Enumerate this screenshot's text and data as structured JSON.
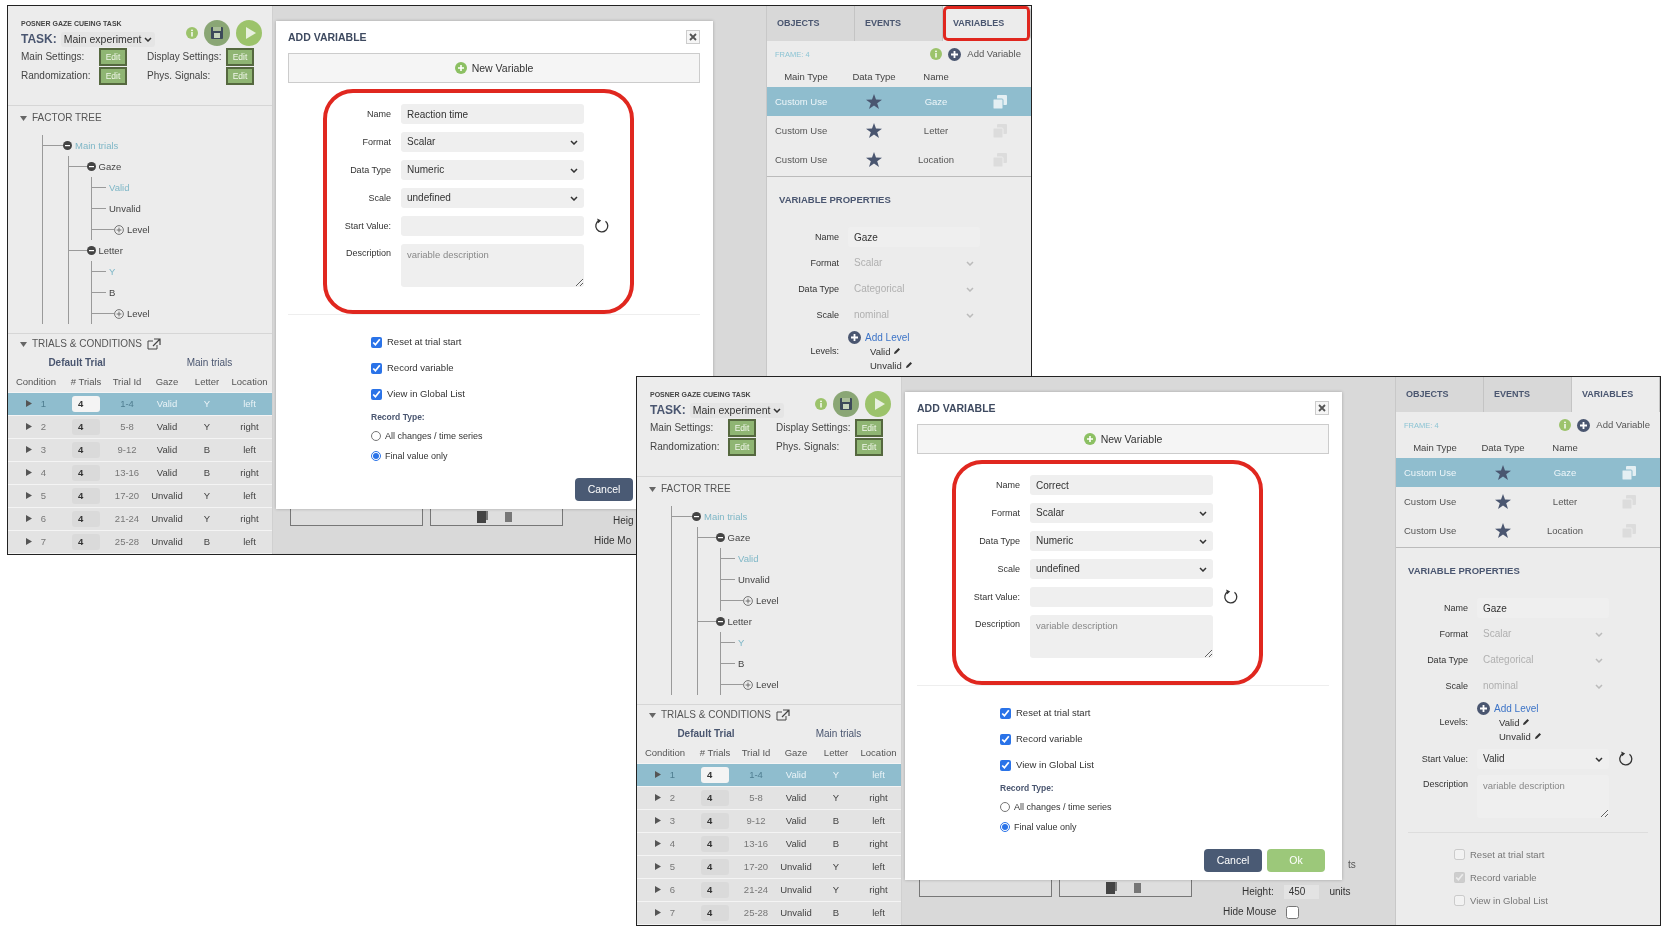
{
  "screenshots": [
    {
      "header": {
        "title": "POSNER GAZE CUEING TASK",
        "task_label": "TASK:",
        "task_value": "Main experiment",
        "settings": [
          {
            "label": "Main Settings:",
            "button": "Edit"
          },
          {
            "label": "Display Settings:",
            "button": "Edit"
          },
          {
            "label": "Randomization:",
            "button": "Edit"
          },
          {
            "label": "Phys. Signals:",
            "button": "Edit"
          }
        ]
      },
      "factor_tree": {
        "title": "FACTOR TREE",
        "nodes": [
          {
            "label": "Main trials",
            "kind": "group",
            "selected": true,
            "children": [
              {
                "label": "Gaze",
                "kind": "factor",
                "selected": false,
                "children": [
                  {
                    "label": "Valid",
                    "kind": "level",
                    "selected": true
                  },
                  {
                    "label": "Unvalid",
                    "kind": "level",
                    "selected": false
                  },
                  {
                    "label": "Level",
                    "kind": "add"
                  }
                ]
              },
              {
                "label": "Letter",
                "kind": "factor",
                "selected": false,
                "children": [
                  {
                    "label": "Y",
                    "kind": "level",
                    "selected": true
                  },
                  {
                    "label": "B",
                    "kind": "level",
                    "selected": false
                  },
                  {
                    "label": "Level",
                    "kind": "add"
                  }
                ]
              }
            ]
          }
        ]
      },
      "trials": {
        "title": "TRIALS & CONDITIONS",
        "groups": [
          "Default Trial",
          "Main trials"
        ],
        "columns": [
          "Condition",
          "# Trials",
          "Trial Id",
          "Gaze",
          "Letter",
          "Location"
        ],
        "rows": [
          {
            "selected": true,
            "cells": [
              "1",
              "4",
              "1-4",
              "Valid",
              "Y",
              "left"
            ]
          },
          {
            "selected": false,
            "cells": [
              "2",
              "4",
              "5-8",
              "Valid",
              "Y",
              "right"
            ]
          },
          {
            "selected": false,
            "cells": [
              "3",
              "4",
              "9-12",
              "Valid",
              "B",
              "left"
            ]
          },
          {
            "selected": false,
            "cells": [
              "4",
              "4",
              "13-16",
              "Valid",
              "B",
              "right"
            ]
          },
          {
            "selected": false,
            "cells": [
              "5",
              "4",
              "17-20",
              "Unvalid",
              "Y",
              "left"
            ]
          },
          {
            "selected": false,
            "cells": [
              "6",
              "4",
              "21-24",
              "Unvalid",
              "Y",
              "right"
            ]
          },
          {
            "selected": false,
            "cells": [
              "7",
              "4",
              "25-28",
              "Unvalid",
              "B",
              "left"
            ]
          }
        ]
      },
      "dialog": {
        "title": "ADD VARIABLE",
        "new_button": "New Variable",
        "highlighted": true,
        "fields": [
          {
            "label": "Name",
            "kind": "text",
            "value": "Reaction time"
          },
          {
            "label": "Format",
            "kind": "select",
            "value": "Scalar"
          },
          {
            "label": "Data Type",
            "kind": "select",
            "value": "Numeric"
          },
          {
            "label": "Scale",
            "kind": "select",
            "value": "undefined"
          },
          {
            "label": "Start Value:",
            "kind": "text",
            "refresh": true
          },
          {
            "label": "Description",
            "kind": "textarea",
            "placeholder": "variable description"
          }
        ],
        "checkboxes": [
          {
            "label": "Reset at trial start",
            "checked": true
          },
          {
            "label": "Record variable",
            "checked": true
          },
          {
            "label": "View in Global List",
            "checked": true
          }
        ],
        "record_type": {
          "label": "Record Type:",
          "options": [
            {
              "label": "All changes / time series",
              "selected": false
            },
            {
              "label": "Final value only",
              "selected": true
            }
          ]
        },
        "buttons": [
          {
            "label": "Cancel",
            "kind": "cancel"
          }
        ]
      },
      "behind_dialog": {
        "height_label": "Heig",
        "hide_mouse_label": "Hide Mo"
      },
      "side_panel": {
        "tabs": [
          {
            "label": "OBJECTS",
            "selected": false,
            "highlighted": false
          },
          {
            "label": "EVENTS",
            "selected": false,
            "highlighted": false
          },
          {
            "label": "VARIABLES",
            "selected": true,
            "highlighted": true
          }
        ],
        "frame_label": "FRAME: 4",
        "add_variable": "Add Variable",
        "columns": [
          "Main Type",
          "Data Type",
          "Name"
        ],
        "variables": [
          {
            "main_type": "Custom Use",
            "name": "Gaze",
            "selected": true
          },
          {
            "main_type": "Custom Use",
            "name": "Letter",
            "selected": false
          },
          {
            "main_type": "Custom Use",
            "name": "Location",
            "selected": false
          }
        ],
        "properties": {
          "title": "VARIABLE PROPERTIES",
          "fields": [
            {
              "label": "Name",
              "kind": "text",
              "value": "Gaze"
            },
            {
              "label": "Format",
              "kind": "select",
              "value": "Scalar",
              "disabled": true
            },
            {
              "label": "Data Type",
              "kind": "select",
              "value": "Categorical",
              "disabled": true
            },
            {
              "label": "Scale",
              "kind": "select",
              "value": "nominal",
              "disabled": true
            },
            {
              "label": "Levels:",
              "kind": "levels",
              "add_label": "Add Level",
              "levels": [
                "Valid",
                "Unvalid"
              ]
            }
          ]
        }
      }
    },
    {
      "header": {
        "title": "POSNER GAZE CUEING TASK",
        "task_label": "TASK:",
        "task_value": "Main experiment",
        "settings": [
          {
            "label": "Main Settings:",
            "button": "Edit"
          },
          {
            "label": "Display Settings:",
            "button": "Edit"
          },
          {
            "label": "Randomization:",
            "button": "Edit"
          },
          {
            "label": "Phys. Signals:",
            "button": "Edit"
          }
        ]
      },
      "factor_tree": {
        "title": "FACTOR TREE",
        "nodes": [
          {
            "label": "Main trials",
            "kind": "group",
            "selected": true,
            "children": [
              {
                "label": "Gaze",
                "kind": "factor",
                "selected": false,
                "children": [
                  {
                    "label": "Valid",
                    "kind": "level",
                    "selected": true
                  },
                  {
                    "label": "Unvalid",
                    "kind": "level",
                    "selected": false
                  },
                  {
                    "label": "Level",
                    "kind": "add"
                  }
                ]
              },
              {
                "label": "Letter",
                "kind": "factor",
                "selected": false,
                "children": [
                  {
                    "label": "Y",
                    "kind": "level",
                    "selected": true
                  },
                  {
                    "label": "B",
                    "kind": "level",
                    "selected": false
                  },
                  {
                    "label": "Level",
                    "kind": "add"
                  }
                ]
              }
            ]
          }
        ]
      },
      "trials": {
        "title": "TRIALS & CONDITIONS",
        "groups": [
          "Default Trial",
          "Main trials"
        ],
        "columns": [
          "Condition",
          "# Trials",
          "Trial Id",
          "Gaze",
          "Letter",
          "Location"
        ],
        "rows": [
          {
            "selected": true,
            "cells": [
              "1",
              "4",
              "1-4",
              "Valid",
              "Y",
              "left"
            ]
          },
          {
            "selected": false,
            "cells": [
              "2",
              "4",
              "5-8",
              "Valid",
              "Y",
              "right"
            ]
          },
          {
            "selected": false,
            "cells": [
              "3",
              "4",
              "9-12",
              "Valid",
              "B",
              "left"
            ]
          },
          {
            "selected": false,
            "cells": [
              "4",
              "4",
              "13-16",
              "Valid",
              "B",
              "right"
            ]
          },
          {
            "selected": false,
            "cells": [
              "5",
              "4",
              "17-20",
              "Unvalid",
              "Y",
              "left"
            ]
          },
          {
            "selected": false,
            "cells": [
              "6",
              "4",
              "21-24",
              "Unvalid",
              "Y",
              "right"
            ]
          },
          {
            "selected": false,
            "cells": [
              "7",
              "4",
              "25-28",
              "Unvalid",
              "B",
              "left"
            ]
          }
        ]
      },
      "dialog": {
        "title": "ADD VARIABLE",
        "new_button": "New Variable",
        "highlighted": true,
        "fields": [
          {
            "label": "Name",
            "kind": "text",
            "value": "Correct"
          },
          {
            "label": "Format",
            "kind": "select",
            "value": "Scalar"
          },
          {
            "label": "Data Type",
            "kind": "select",
            "value": "Numeric"
          },
          {
            "label": "Scale",
            "kind": "select",
            "value": "undefined"
          },
          {
            "label": "Start Value:",
            "kind": "text",
            "refresh": true
          },
          {
            "label": "Description",
            "kind": "textarea",
            "placeholder": "variable description"
          }
        ],
        "checkboxes": [
          {
            "label": "Reset at trial start",
            "checked": true
          },
          {
            "label": "Record variable",
            "checked": true
          },
          {
            "label": "View in Global List",
            "checked": true
          }
        ],
        "record_type": {
          "label": "Record Type:",
          "options": [
            {
              "label": "All changes / time series",
              "selected": false
            },
            {
              "label": "Final value only",
              "selected": true
            }
          ]
        },
        "buttons": [
          {
            "label": "Cancel",
            "kind": "cancel"
          },
          {
            "label": "Ok",
            "kind": "ok"
          }
        ]
      },
      "behind_dialog": {
        "fragment": "ts",
        "height_label": "Height:",
        "height_value": "450",
        "units": "units",
        "hide_mouse_label": "Hide Mouse",
        "hide_mouse_checked": false
      },
      "side_panel": {
        "tabs": [
          {
            "label": "OBJECTS",
            "selected": false,
            "highlighted": false
          },
          {
            "label": "EVENTS",
            "selected": false,
            "highlighted": false
          },
          {
            "label": "VARIABLES",
            "selected": true,
            "highlighted": false
          }
        ],
        "frame_label": "FRAME: 4",
        "add_variable": "Add Variable",
        "columns": [
          "Main Type",
          "Data Type",
          "Name"
        ],
        "variables": [
          {
            "main_type": "Custom Use",
            "name": "Gaze",
            "selected": true
          },
          {
            "main_type": "Custom Use",
            "name": "Letter",
            "selected": false
          },
          {
            "main_type": "Custom Use",
            "name": "Location",
            "selected": false
          }
        ],
        "properties": {
          "title": "VARIABLE PROPERTIES",
          "fields": [
            {
              "label": "Name",
              "kind": "text",
              "value": "Gaze"
            },
            {
              "label": "Format",
              "kind": "select",
              "value": "Scalar",
              "disabled": true
            },
            {
              "label": "Data Type",
              "kind": "select",
              "value": "Categorical",
              "disabled": true
            },
            {
              "label": "Scale",
              "kind": "select",
              "value": "nominal",
              "disabled": true
            },
            {
              "label": "Levels:",
              "kind": "levels",
              "add_label": "Add Level",
              "levels": [
                "Valid",
                "Unvalid"
              ]
            },
            {
              "label": "Start Value:",
              "kind": "select",
              "value": "Valid",
              "refresh": true
            },
            {
              "label": "Description",
              "kind": "textarea",
              "placeholder": "variable description"
            }
          ],
          "checkboxes": [
            {
              "label": "Reset at trial start",
              "checked": false,
              "disabled": true
            },
            {
              "label": "Record variable",
              "checked": true,
              "disabled": true
            },
            {
              "label": "View in Global List",
              "checked": false,
              "disabled": true
            }
          ]
        }
      }
    }
  ]
}
